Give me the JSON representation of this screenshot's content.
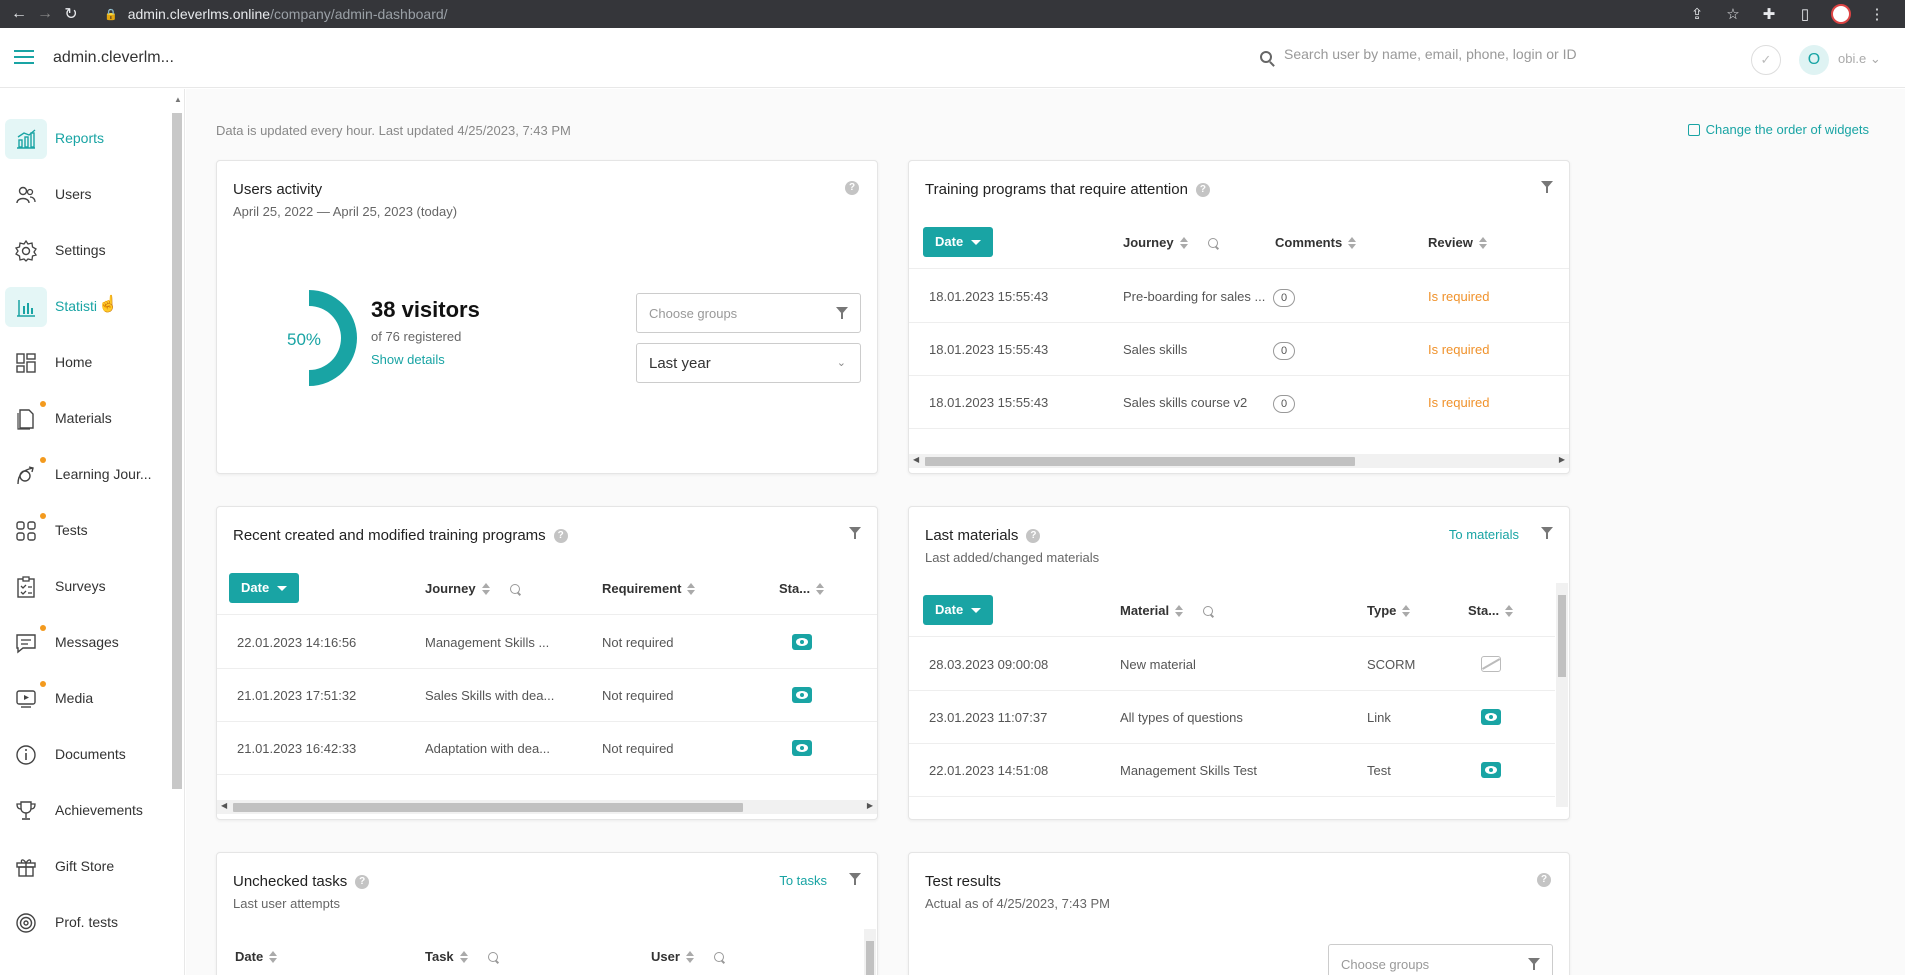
{
  "browser": {
    "url_domain": "admin.cleverlms.online",
    "url_path": "/company/admin-dashboard/"
  },
  "header": {
    "app_title": "admin.cleverlm...",
    "search_placeholder": "Search user by name, email, phone, login or ID",
    "avatar_letter": "O",
    "user_name": "obi.e"
  },
  "sidebar": {
    "items": [
      {
        "label": "Reports",
        "icon": "reports-chart-icon",
        "active": true
      },
      {
        "label": "Users",
        "icon": "users-icon"
      },
      {
        "label": "Settings",
        "icon": "gear-icon"
      },
      {
        "label": "Statisti",
        "icon": "bar-chart-icon",
        "active": true
      },
      {
        "label": "Home",
        "icon": "dashboard-icon"
      },
      {
        "label": "Materials",
        "icon": "document-icon",
        "dot": true
      },
      {
        "label": "Learning Jour...",
        "icon": "journey-icon",
        "dot": true
      },
      {
        "label": "Tests",
        "icon": "grid-icon",
        "dot": true
      },
      {
        "label": "Surveys",
        "icon": "checklist-icon"
      },
      {
        "label": "Messages",
        "icon": "message-icon",
        "dot": true
      },
      {
        "label": "Media",
        "icon": "media-play-icon",
        "dot": true
      },
      {
        "label": "Documents",
        "icon": "info-icon"
      },
      {
        "label": "Achievements",
        "icon": "trophy-icon"
      },
      {
        "label": "Gift Store",
        "icon": "gift-icon"
      },
      {
        "label": "Prof. tests",
        "icon": "target-icon"
      }
    ]
  },
  "main": {
    "updated_note": "Data is updated every hour. Last updated 4/25/2023, 7:43 PM",
    "change_order": "Change the order of widgets"
  },
  "users_activity": {
    "title": "Users activity",
    "subtitle": "April 25, 2022 — April 25, 2023 (today)",
    "percent_label": "50%",
    "percent_value": 0.5,
    "visitors": "38 visitors",
    "registered": "of 76 registered",
    "show_details": "Show details",
    "groups_placeholder": "Choose groups",
    "period": "Last year"
  },
  "attention": {
    "title": "Training programs that require attention",
    "headers": {
      "date": "Date",
      "journey": "Journey",
      "comments": "Comments",
      "review": "Review"
    },
    "rows": [
      {
        "date": "18.01.2023 15:55:43",
        "journey": "Pre-boarding for sales ...",
        "comments": "0",
        "review": "Is required"
      },
      {
        "date": "18.01.2023 15:55:43",
        "journey": "Sales skills",
        "comments": "0",
        "review": "Is required"
      },
      {
        "date": "18.01.2023 15:55:43",
        "journey": "Sales skills course v2",
        "comments": "0",
        "review": "Is required"
      }
    ]
  },
  "recent_programs": {
    "title": "Recent created and modified training programs",
    "headers": {
      "date": "Date",
      "journey": "Journey",
      "requirement": "Requirement",
      "status": "Sta..."
    },
    "rows": [
      {
        "date": "22.01.2023 14:16:56",
        "journey": "Management Skills ...",
        "requirement": "Not required",
        "status": "visible"
      },
      {
        "date": "21.01.2023 17:51:32",
        "journey": "Sales Skills with dea...",
        "requirement": "Not required",
        "status": "visible"
      },
      {
        "date": "21.01.2023 16:42:33",
        "journey": "Adaptation with dea...",
        "requirement": "Not required",
        "status": "visible"
      }
    ]
  },
  "last_materials": {
    "title": "Last materials",
    "subtitle": "Last added/changed materials",
    "link": "To materials",
    "headers": {
      "date": "Date",
      "material": "Material",
      "type": "Type",
      "status": "Sta..."
    },
    "rows": [
      {
        "date": "28.03.2023 09:00:08",
        "material": "New material",
        "type": "SCORM",
        "status": "hidden"
      },
      {
        "date": "23.01.2023 11:07:37",
        "material": "All types of questions",
        "type": "Link",
        "status": "visible"
      },
      {
        "date": "22.01.2023 14:51:08",
        "material": "Management Skills Test",
        "type": "Test",
        "status": "visible"
      }
    ]
  },
  "unchecked_tasks": {
    "title": "Unchecked tasks",
    "subtitle": "Last user attempts",
    "link": "To tasks",
    "headers": {
      "date": "Date",
      "task": "Task",
      "user": "User"
    }
  },
  "test_results": {
    "title": "Test results",
    "subtitle": "Actual as of 4/25/2023, 7:43 PM",
    "groups_placeholder": "Choose groups"
  },
  "colors": {
    "accent": "#19a4a4",
    "warning": "#f0922b",
    "dot": "#f39a1e"
  }
}
